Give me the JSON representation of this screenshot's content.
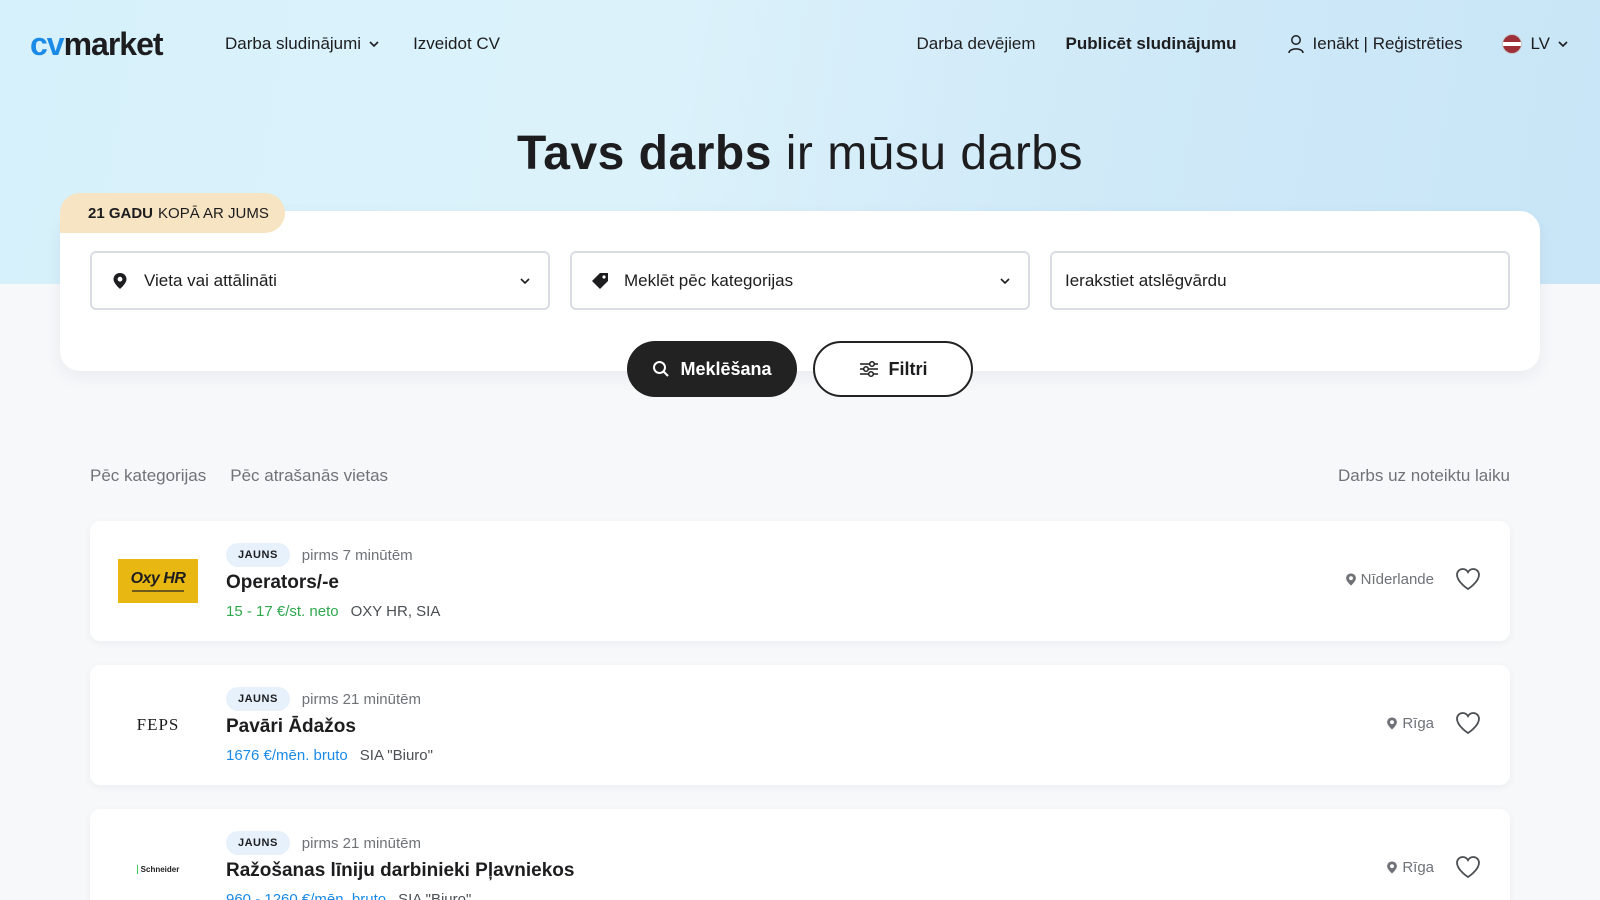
{
  "header": {
    "logo_cv": "cv",
    "logo_market": "market",
    "nav": [
      "Darba sludinājumi",
      "Izveidot CV"
    ],
    "employers": "Darba devējiem",
    "publish": "Publicēt sludinājumu",
    "login": "Ienākt | Reģistrēties",
    "lang": "LV"
  },
  "hero": {
    "title_bold": "Tavs darbs",
    "title_rest": " ir mūsu darbs",
    "badge_bold": "21 GADU",
    "badge_rest": "KOPĀ AR JUMS"
  },
  "search": {
    "location": "Vieta vai attālināti",
    "category": "Meklēt pēc kategorijas",
    "keyword_placeholder": "Ierakstiet atslēgvārdu",
    "search_button": "Meklēšana",
    "filter_button": "Filtri"
  },
  "tabs": {
    "by_category": "Pēc kategorijas",
    "by_location": "Pēc atrašanās vietas",
    "temporary": "Darbs uz noteiktu laiku"
  },
  "jobs": [
    {
      "badge": "JAUNS",
      "time": "pirms 7 minūtēm",
      "title": "Operators/-e",
      "salary": "15 - 17 €/st. neto",
      "company": "OXY HR, SIA",
      "location": "Nīderlande",
      "logo_text": "Oxy HR"
    },
    {
      "badge": "JAUNS",
      "time": "pirms 21 minūtēm",
      "title": "Pavāri Ādažos",
      "salary": "1676 €/mēn. bruto",
      "company": "SIA \"Biuro\"",
      "location": "Rīga",
      "logo_text": "FEPS"
    },
    {
      "badge": "JAUNS",
      "time": "pirms 21 minūtēm",
      "title": "Ražošanas līniju darbinieki Pļavniekos",
      "salary": "960 - 1260 €/mēn. bruto",
      "company": "SIA \"Biuro\"",
      "location": "Rīga",
      "logo_text": "Schneider"
    }
  ],
  "colors": {
    "accent_blue": "#1b8ae6",
    "salary_green": "#2ea84f",
    "badge_beige": "#f7e4c2"
  }
}
